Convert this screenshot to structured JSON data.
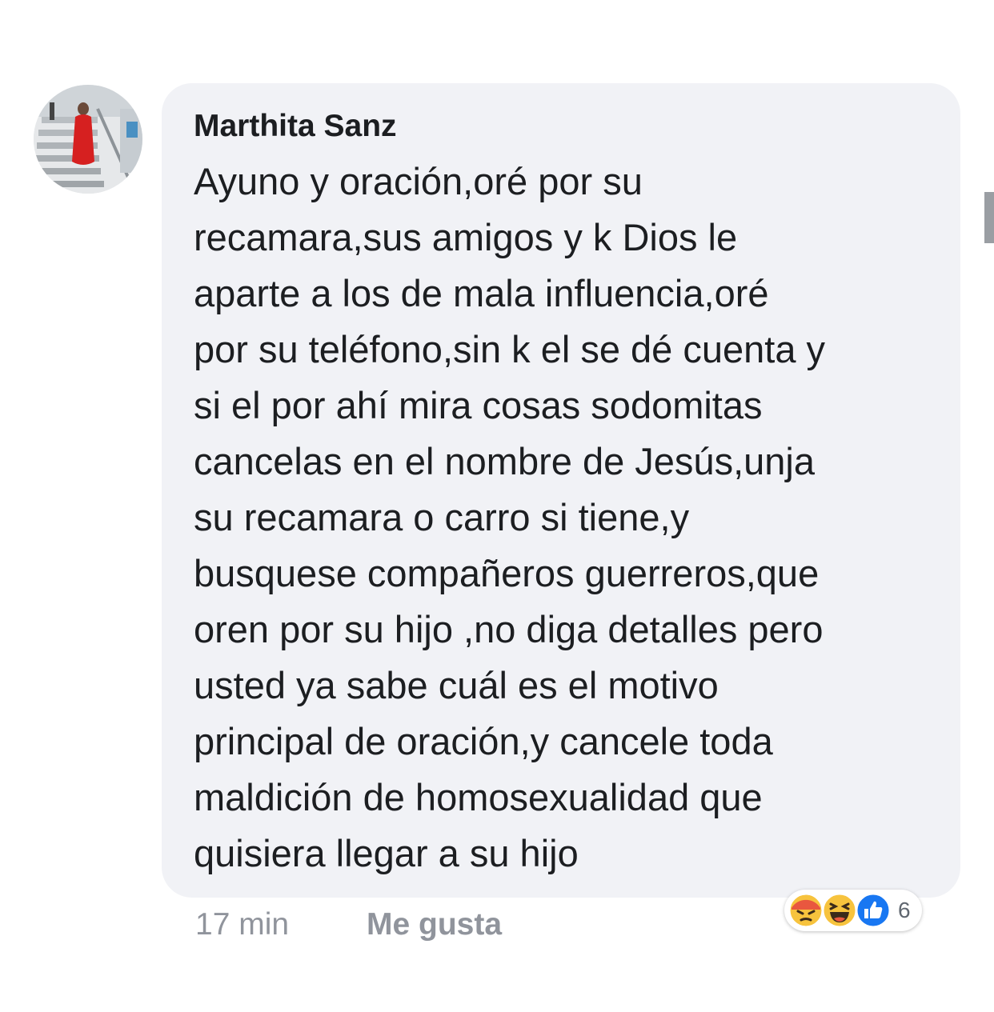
{
  "comment": {
    "author": "Marthita Sanz",
    "lines": [
      "Ayuno y oración,oré por su",
      "recamara,sus amigos y k Dios le",
      "aparte a los de mala influencia,oré",
      "por su teléfono,sin k el se dé cuenta y",
      "si el por ahí mira cosas sodomitas",
      "cancelas en el nombre de Jesús,unja",
      "su recamara o carro si tiene,y",
      "busquese compañeros guerreros,que",
      "oren por su hijo ,no diga detalles pero",
      "usted ya sabe cuál es el motivo",
      "principal de oración,y cancele toda",
      "maldición de homosexualidad que",
      "quisiera llegar a su hijo"
    ]
  },
  "meta": {
    "time": "17 min",
    "like_label": "Me gusta"
  },
  "reactions": {
    "icons": [
      "angry-icon",
      "haha-icon",
      "like-icon"
    ],
    "count": "6"
  },
  "colors": {
    "bubble": "#f1f2f6",
    "text": "#1c1e21",
    "meta": "#90949c",
    "like_blue": "#1877f2",
    "angry_red": "#e9573f",
    "haha_yellow": "#f7c33d"
  }
}
